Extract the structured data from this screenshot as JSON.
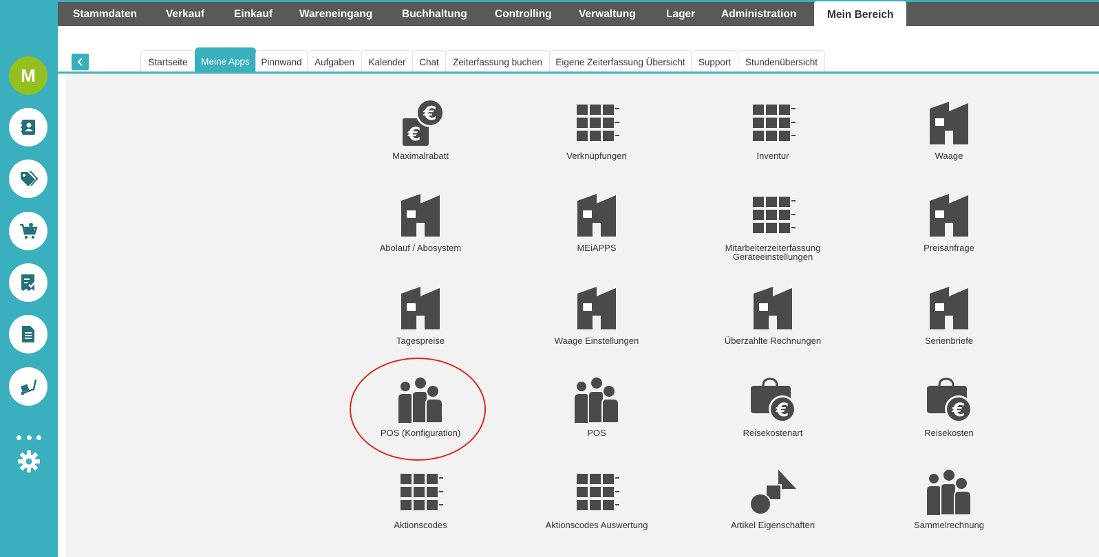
{
  "sidebar": {
    "avatar_letter": "M",
    "icons": [
      "contacts-icon",
      "tags-icon",
      "cart-icon",
      "checklist-icon",
      "document-icon",
      "hand-truck-icon"
    ],
    "settings_icon": "gear-icon",
    "more_icon": "more-dots-icon"
  },
  "topnav": {
    "items": [
      "Stammdaten",
      "Verkauf",
      "Einkauf",
      "Wareneingang",
      "Buchhaltung",
      "Controlling",
      "Verwaltung",
      "Lager",
      "Administration",
      "Mein Bereich"
    ],
    "active": "Mein Bereich"
  },
  "subtabs": {
    "items": [
      "Startseite",
      "Meine Apps",
      "Pinnwand",
      "Aufgaben",
      "Kalender",
      "Chat",
      "Zeiterfassung buchen",
      "Eigene Zeiterfassung Übersicht",
      "Support",
      "Stundenübersicht"
    ],
    "active": "Meine Apps"
  },
  "apps": [
    {
      "label": "Maximalrabatt",
      "icon": "euro-coins-icon"
    },
    {
      "label": "Verknüpfungen",
      "icon": "grid-list-icon"
    },
    {
      "label": "Inventur",
      "icon": "grid-list-icon"
    },
    {
      "label": "Waage",
      "icon": "factory-icon"
    },
    {
      "label": "Abolauf / Abosystem",
      "icon": "factory-icon"
    },
    {
      "label": "MEiAPPS",
      "icon": "factory-icon"
    },
    {
      "label": "Mitarbeiterzeiterfassung\nGeräteeinstellungen",
      "icon": "grid-list-icon"
    },
    {
      "label": "Preisanfrage",
      "icon": "factory-icon"
    },
    {
      "label": "Tagespreise",
      "icon": "factory-icon"
    },
    {
      "label": "Waage Einstellungen",
      "icon": "factory-icon"
    },
    {
      "label": "Überzahlte Rechnungen",
      "icon": "factory-icon"
    },
    {
      "label": "Serienbriefe",
      "icon": "factory-icon"
    },
    {
      "label": "POS (Konfiguration)",
      "icon": "people-group-icon"
    },
    {
      "label": "POS",
      "icon": "people-group-icon"
    },
    {
      "label": "Reisekostenart",
      "icon": "euro-bag-icon"
    },
    {
      "label": "Reisekosten",
      "icon": "euro-bag-icon"
    },
    {
      "label": "Aktionscodes",
      "icon": "grid-list-icon"
    },
    {
      "label": "Aktionscodes Auswertung",
      "icon": "grid-list-icon"
    },
    {
      "label": "Artikel Eigenschaften",
      "icon": "shapes-icon"
    },
    {
      "label": "Sammelrechnung",
      "icon": "people-group-icon"
    }
  ],
  "colors": {
    "accent": "#3aafbd",
    "nav_bg": "#595959",
    "avatar": "#93c01f",
    "icon_gray": "#4a4a4a",
    "highlight": "#e2261a"
  }
}
